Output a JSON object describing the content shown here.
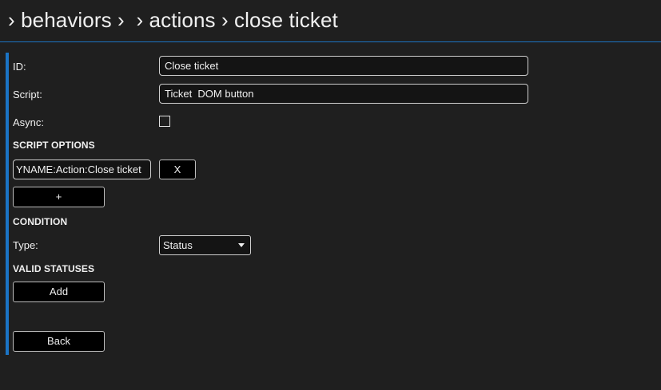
{
  "breadcrumb": {
    "parts": [
      "› behaviors ›",
      "› actions › close ticket"
    ]
  },
  "form": {
    "id_label": "ID:",
    "id_value": "Close ticket",
    "script_label": "Script:",
    "script_value": "Ticket  DOM button",
    "async_label": "Async:",
    "async_checked": false,
    "script_options_title": "SCRIPT OPTIONS",
    "script_option_value": "YNAME:Action:Close ticket",
    "remove_option_label": "X",
    "add_option_label": "+",
    "condition_title": "CONDITION",
    "type_label": "Type:",
    "type_value": "Status",
    "valid_statuses_title": "VALID STATUSES",
    "add_status_label": "Add",
    "back_label": "Back"
  },
  "colors": {
    "accent": "#1b74c5",
    "background": "#1f1f1f",
    "button_bg": "#000000"
  }
}
